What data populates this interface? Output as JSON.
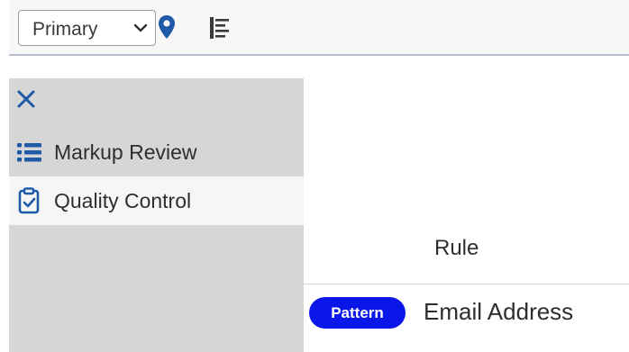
{
  "toolbar": {
    "view_select": {
      "value": "Primary",
      "icon": "chevron-down-icon"
    },
    "location_icon": "map-pin-icon",
    "outline_icon": "outline-icon"
  },
  "sidebar": {
    "close_icon": "close-icon",
    "items": [
      {
        "label": "Markup Review",
        "icon": "list-icon",
        "active": false
      },
      {
        "label": "Quality Control",
        "icon": "clipboard-check-icon",
        "active": true
      }
    ]
  },
  "main": {
    "column_header": "Rule",
    "rows": [
      {
        "badge": "Pattern",
        "name": "Email Address"
      }
    ]
  },
  "colors": {
    "accent": "#1f5aa8",
    "badge_bg": "#0a17e8",
    "sidebar_bg": "#d6d6d6",
    "active_item_bg": "#f6f6f6"
  }
}
